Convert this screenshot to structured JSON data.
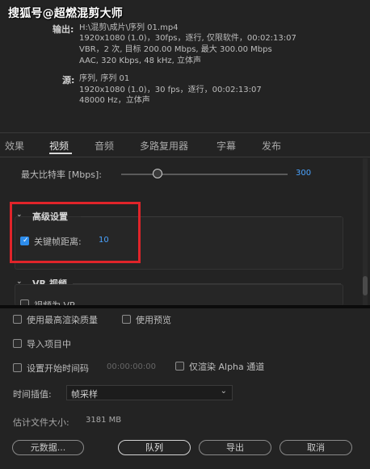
{
  "watermark": "搜狐号@超燃混剪大师",
  "output": {
    "label": "输出:",
    "line1": "H:\\混剪\\成片\\序列 01.mp4",
    "line2": "1920x1080 (1.0)，30fps，逐行, 仅限软件，00:02:13:07",
    "line3": "VBR，2 次, 目标 200.00 Mbps, 最大 300.00 Mbps",
    "line4": "AAC, 320 Kbps, 48  kHz, 立体声"
  },
  "source": {
    "label": "源:",
    "line1": "序列, 序列 01",
    "line2": "1920x1080 (1.0)，30 fps，逐行，00:02:13:07",
    "line3": "48000 Hz，立体声"
  },
  "tabs": [
    "效果",
    "视频",
    "音频",
    "多路复用器",
    "字幕",
    "发布"
  ],
  "active_tab": "视频",
  "bitrate": {
    "label": "最大比特率 [Mbps]:",
    "value": "300",
    "slider_fraction": 0.22
  },
  "advanced": {
    "title": "高级设置",
    "keyframe_label": "关键帧距离:",
    "keyframe_value": "10",
    "checked": true
  },
  "vr": {
    "title": "VR 视频",
    "partial_item": "视频为 VR"
  },
  "options": {
    "max_quality": "使用最高渲染质量",
    "use_preview": "使用预览",
    "import_project": "导入项目中",
    "set_start_tc": "设置开始时间码",
    "start_tc_value": "00:00:00:00",
    "alpha_only": "仅渲染 Alpha 通道"
  },
  "interp": {
    "label": "时间插值:",
    "value": "帧采样"
  },
  "filesize": {
    "label": "估计文件大小:",
    "value": "3181 MB"
  },
  "buttons": {
    "metadata": "元数据...",
    "queue": "队列",
    "export": "导出",
    "cancel": "取消"
  },
  "icons": [
    "chevron-down-icon",
    "check-icon",
    "dropdown-arrow-icon"
  ]
}
